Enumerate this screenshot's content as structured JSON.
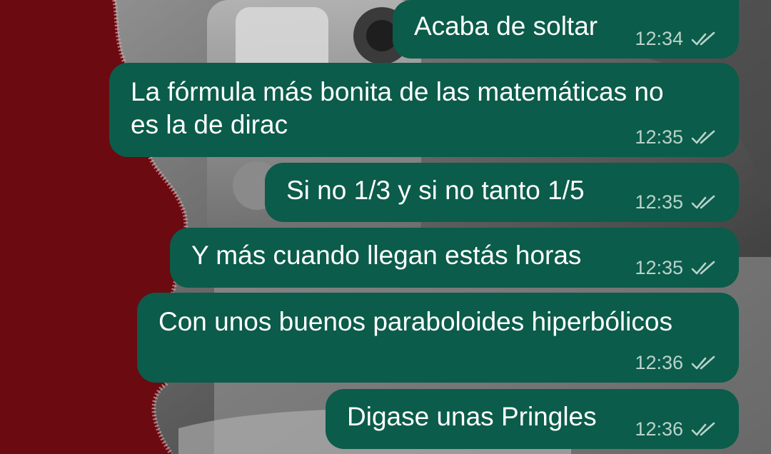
{
  "chat": {
    "messages": [
      {
        "text": "Acaba de soltar",
        "time": "12:34",
        "status": "read-double-check-icon"
      },
      {
        "text": "La fórmula más bonita de las matemáticas no\nes la de dirac",
        "time": "12:35",
        "status": "read-double-check-icon"
      },
      {
        "text": "Si no 1/3 y si no tanto 1/5",
        "time": "12:35",
        "status": "read-double-check-icon"
      },
      {
        "text": "Y más cuando llegan estás horas",
        "time": "12:35",
        "status": "read-double-check-icon"
      },
      {
        "text": "Con unos buenos paraboloides hiperbólicos",
        "time": "12:36",
        "status": "read-double-check-icon"
      },
      {
        "text": "Digase unas Pringles",
        "time": "12:36",
        "status": "read-double-check-icon"
      }
    ]
  },
  "colors": {
    "bubble": "#0b5c4a",
    "message_text": "#ffffff",
    "timestamp": "#b9d3cb",
    "wallpaper_dark_red": "#6b0a10"
  }
}
